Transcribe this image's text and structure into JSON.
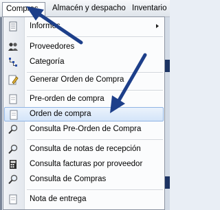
{
  "menubar": {
    "items": [
      "Compras",
      "Almacén y despacho",
      "Inventario"
    ]
  },
  "menu": {
    "items": [
      {
        "label": "Informes",
        "icon": "reports-icon",
        "submenu": true
      },
      {
        "label": "Proveedores",
        "icon": "suppliers-icon"
      },
      {
        "label": "Categoría",
        "icon": "category-tree-icon"
      },
      {
        "label": "Generar Orden de Compra",
        "icon": "edit-document-icon"
      },
      {
        "label": "Pre-orden de compra",
        "icon": "document-icon"
      },
      {
        "label": "Orden de compra",
        "icon": "document-icon",
        "highlighted": true
      },
      {
        "label": "Consulta Pre-Orden de Compra",
        "icon": "magnifier-icon"
      },
      {
        "label": "Consulta de notas de recepción",
        "icon": "magnifier-icon"
      },
      {
        "label": "Consulta facturas por proveedor",
        "icon": "calculator-icon"
      },
      {
        "label": "Consulta de Compras",
        "icon": "magnifier-icon"
      },
      {
        "label": "Nota de entrega",
        "icon": "document-icon"
      }
    ]
  },
  "colors": {
    "highlight_fill": "#d4e5f9",
    "highlight_border": "#8fb4e4",
    "annotation_arrow": "#1d3f8a"
  }
}
